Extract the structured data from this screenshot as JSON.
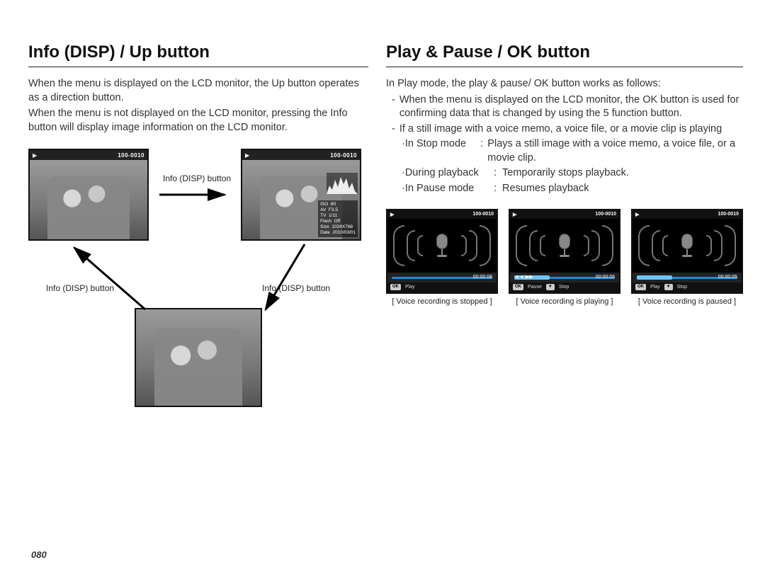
{
  "page_number": "080",
  "left": {
    "heading": "Info (DISP) / Up button",
    "para1": "When the menu is displayed on the LCD monitor, the Up button operates as a direction button.",
    "para2": "When the menu is not displayed on the LCD monitor, pressing the Info button will display image information on the LCD monitor.",
    "arrow_labels": {
      "top": "Info (DISP) button",
      "left": "Info (DISP) button",
      "right": "Info (DISP) button"
    },
    "file_counter": "100-0010",
    "info_overlay": "ISO  80\nAV  F3.5\nTV  1/11\nFlash  Off\nSize  1024X768\nDate  2010/03/01"
  },
  "right": {
    "heading": "Play & Pause / OK button",
    "intro": "In Play mode, the play & pause/ OK button works as follows:",
    "dash1": "When the menu is displayed on the LCD monitor, the OK button is used for confirming data that is changed by using the 5 function button.",
    "dash2": "If a still image with a voice memo, a voice file, or a movie clip is playing",
    "modes": [
      {
        "name": "·In Stop mode",
        "desc": "Plays a still image with a voice memo, a voice file, or a movie clip."
      },
      {
        "name": "·During playback",
        "desc": "Temporarily stops playback."
      },
      {
        "name": "·In Pause mode",
        "desc": "Resumes playback"
      }
    ],
    "voice": {
      "file_counter": "100-0010",
      "screens": [
        {
          "time": "00:00:08",
          "controls_left": "",
          "bottom": [
            {
              "k": "OK",
              "l": "Play"
            }
          ],
          "caption": "[ Voice recording is stopped ]"
        },
        {
          "time": "00:00:05",
          "controls_left": "◄◄  ▶▶",
          "bottom": [
            {
              "k": "OK",
              "l": "Pause"
            },
            {
              "k": "▼",
              "l": "Stop"
            }
          ],
          "caption": "[ Voice recording is playing ]"
        },
        {
          "time": "00:00:05",
          "controls_left": "",
          "bottom": [
            {
              "k": "OK",
              "l": "Play"
            },
            {
              "k": "▼",
              "l": "Stop"
            }
          ],
          "caption": "[ Voice recording is paused ]"
        }
      ]
    }
  }
}
